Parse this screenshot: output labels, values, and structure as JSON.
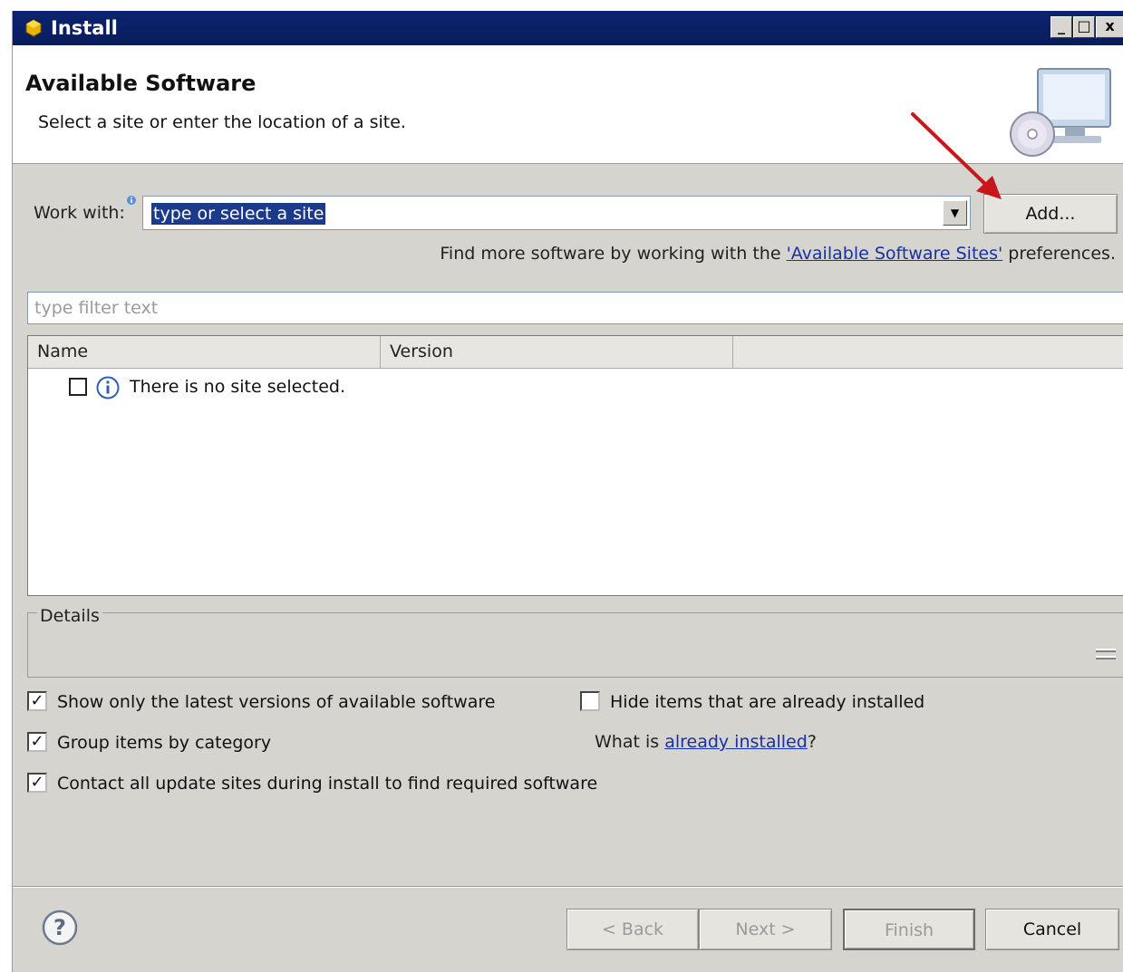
{
  "window": {
    "title": "Install",
    "controls": [
      "_",
      "□",
      "x"
    ]
  },
  "header": {
    "title": "Available Software",
    "description": "Select a site or enter the location of a site."
  },
  "work_with": {
    "label": "Work with:",
    "value": "type or select a site",
    "add_label": "Add...",
    "find_more_prefix": "Find more software by working with the ",
    "find_more_link": "'Available Software Sites'",
    "find_more_suffix": " preferences."
  },
  "filter": {
    "placeholder": "type filter text"
  },
  "table": {
    "columns": [
      "Name",
      "Version",
      ""
    ],
    "rows": [
      {
        "text": "There is no site selected.",
        "checked": false,
        "icon": "info-icon"
      }
    ]
  },
  "details": {
    "label": "Details"
  },
  "options": {
    "show_latest": {
      "label": "Show only the latest versions of available software",
      "checked": true
    },
    "group_by_category": {
      "label": "Group items by category",
      "checked": true
    },
    "contact_all_sites": {
      "label": "Contact all update sites during install to find required software",
      "checked": true
    },
    "hide_installed": {
      "label": "Hide items that are already installed",
      "checked": false
    },
    "what_prefix": "What is ",
    "what_link": "already installed",
    "what_suffix": "?"
  },
  "buttons": {
    "back": "< Back",
    "next": "Next >",
    "finish": "Finish",
    "cancel": "Cancel"
  },
  "colors": {
    "titlebar": "#0c2470",
    "link": "#1a2fa8",
    "selection": "#1b3a8c",
    "annotation_arrow": "#c8161d"
  }
}
